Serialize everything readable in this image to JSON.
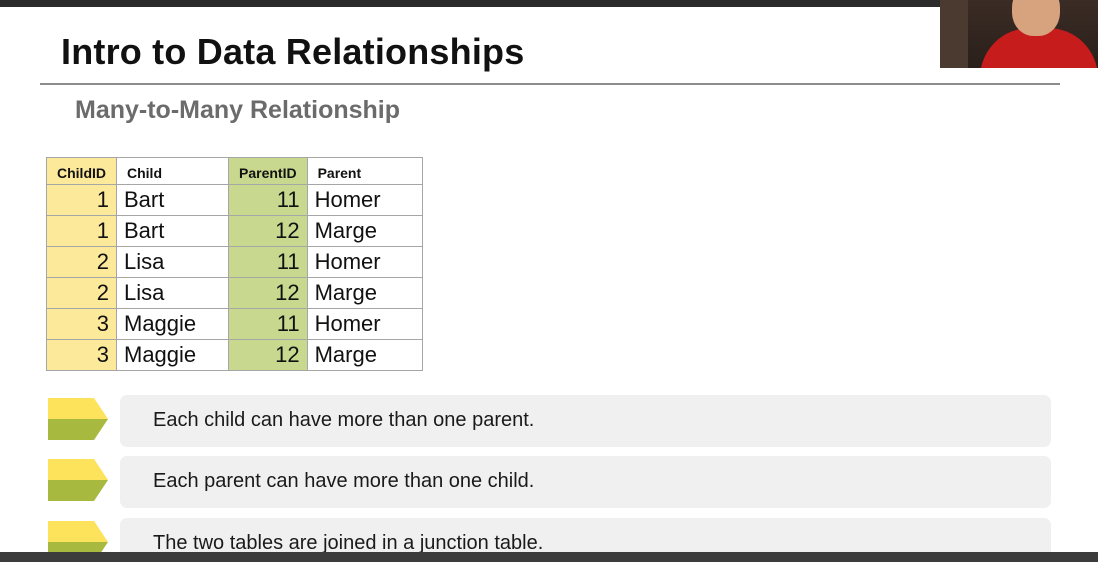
{
  "slide": {
    "title": "Intro to Data Relationships",
    "subtitle": "Many-to-Many Relationship"
  },
  "table": {
    "headers": [
      "ChildID",
      "Child",
      "ParentID",
      "Parent"
    ],
    "rows": [
      [
        "1",
        "Bart",
        "11",
        "Homer"
      ],
      [
        "1",
        "Bart",
        "12",
        "Marge"
      ],
      [
        "2",
        "Lisa",
        "11",
        "Homer"
      ],
      [
        "2",
        "Lisa",
        "12",
        "Marge"
      ],
      [
        "3",
        "Maggie",
        "11",
        "Homer"
      ],
      [
        "3",
        "Maggie",
        "12",
        "Marge"
      ]
    ],
    "colors": {
      "id_child": "#fde99a",
      "id_parent": "#c8d88f"
    }
  },
  "bullets": [
    "Each child can have more than one parent.",
    "Each parent can have more than one child.",
    "The two tables are joined in a junction table."
  ],
  "colors": {
    "arrow_top": "#fde25b",
    "arrow_bottom": "#a8b93f",
    "callout_bg": "#f0f0f0",
    "title": "#111111",
    "subtitle": "#6b6b6b"
  },
  "icons": {
    "bullet": "arrow-bullet-icon"
  }
}
